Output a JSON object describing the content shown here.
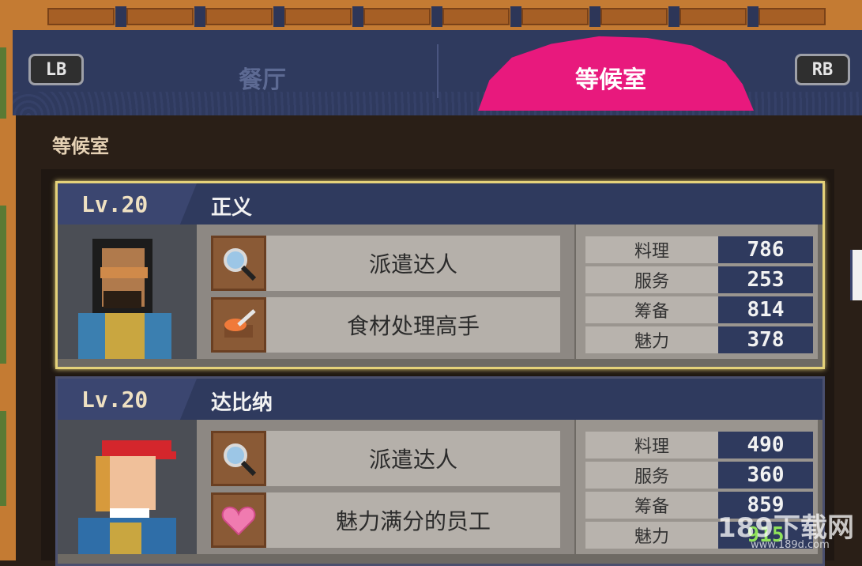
{
  "tabs": {
    "left_button": "LB",
    "right_button": "RB",
    "restaurant": "餐厅",
    "waiting_room": "等候室"
  },
  "section_title": "等候室",
  "colors": {
    "accent_pink": "#e8197d",
    "selected_border": "#e5d27a",
    "header_blue": "#2f3a5e"
  },
  "cards": [
    {
      "level": "Lv.20",
      "name": "正义",
      "skills": [
        {
          "icon": "magnifier-icon",
          "label": "派遣达人"
        },
        {
          "icon": "knife-food-icon",
          "label": "食材处理高手"
        }
      ],
      "stats": [
        {
          "label": "料理",
          "value": "786"
        },
        {
          "label": "服务",
          "value": "253"
        },
        {
          "label": "筹备",
          "value": "814"
        },
        {
          "label": "魅力",
          "value": "378"
        }
      ]
    },
    {
      "level": "Lv.20",
      "name": "达比纳",
      "skills": [
        {
          "icon": "magnifier-icon",
          "label": "派遣达人"
        },
        {
          "icon": "heart-icon",
          "label": "魅力满分的员工"
        }
      ],
      "stats": [
        {
          "label": "料理",
          "value": "490"
        },
        {
          "label": "服务",
          "value": "360"
        },
        {
          "label": "筹备",
          "value": "859"
        },
        {
          "label": "魅力",
          "value": "915"
        }
      ]
    }
  ],
  "watermark": {
    "text": "189下载网",
    "url": "www.189d.com"
  }
}
